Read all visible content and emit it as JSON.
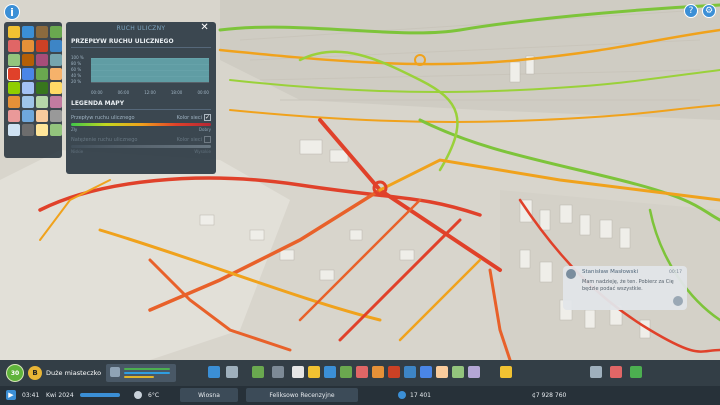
{
  "top_left": {
    "info_label": "i"
  },
  "top_right": {
    "help_label": "?",
    "settings_icon": "gear-icon"
  },
  "traffic_panel": {
    "title": "RUCH ULICZNY",
    "section_flow": "PRZEPŁYW RUCHU ULICZNEGO",
    "y_ticks": [
      "100 %",
      "80 %",
      "60 %",
      "40 %",
      "20 %"
    ],
    "x_ticks": [
      "00:00",
      "06:00",
      "12:00",
      "18:00",
      "00:00"
    ],
    "section_legend": "LEGENDA MAPY",
    "legend_flow_label": "Przepływ ruchu ulicznego",
    "legend_flow_color_label": "Kolor sieci",
    "legend_flow_checked": true,
    "legend_flow_low": "Zły",
    "legend_flow_high": "Dobry",
    "legend_volume_label": "Natężenie ruchu ulicznego",
    "legend_volume_color_label": "Kolor sieci",
    "legend_volume_checked": false,
    "legend_volume_low": "Niskie",
    "legend_volume_high": "Wysokie"
  },
  "chirp": {
    "author": "Stanisław Masłowski",
    "time": "00:17",
    "message": "Mam nadzieję, że ten. Pobierz za Cię będzie podać wszystkie."
  },
  "city_bar": {
    "level": "30",
    "milestone": "B",
    "city_size": "Duże miasteczko"
  },
  "status_bar": {
    "time": "03:41",
    "date": "Kwi 2024",
    "temperature": "6°C",
    "season": "Wiosna",
    "city_name": "Feliksowo Recenzyjne",
    "population": "17 401",
    "money": "¢7 928 760"
  },
  "colors": {
    "traffic_good": "#3fc64a",
    "traffic_medium": "#f0a21c",
    "traffic_bad": "#e0412a",
    "ui_panel": "#2a3742",
    "accent": "#3b8fd6"
  }
}
